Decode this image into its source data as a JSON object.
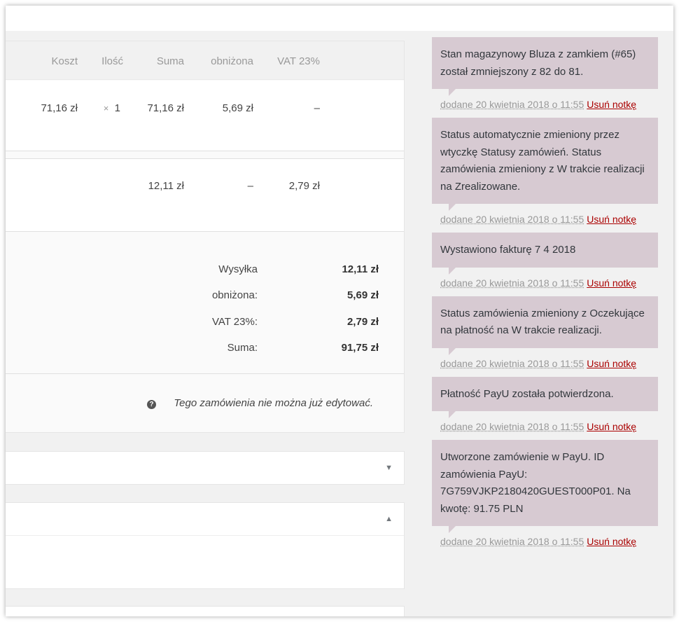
{
  "items_table": {
    "columns": [
      "Koszt",
      "Ilość",
      "Suma",
      "obniżona",
      "VAT 23%"
    ],
    "product_row": {
      "cost": "71,16 zł",
      "qty_x": "×",
      "qty": "1",
      "total": "71,16 zł",
      "discount": "5,69 zł",
      "vat": "–"
    },
    "shipping_row": {
      "total": "12,11 zł",
      "discount": "–",
      "vat": "2,79 zł"
    }
  },
  "totals": [
    {
      "label": "Wysyłka",
      "value": "12,11 zł"
    },
    {
      "label": "obniżona:",
      "value": "5,69 zł"
    },
    {
      "label": "VAT 23%:",
      "value": "2,79 zł"
    },
    {
      "label": "Suma:",
      "value": "91,75 zł"
    }
  ],
  "notice": {
    "icon": "?",
    "text": "Tego zamówienia nie można już edytować."
  },
  "boxes": {
    "box1_toggle": "▼",
    "box2_toggle": "▲"
  },
  "colors": {
    "note_bg": "#d7cad2",
    "delete_link": "#aa0000"
  },
  "notes": [
    {
      "text": "Stan magazynowy Bluza z zamkiem (#65) został zmniejszony z 82 do 81.",
      "date": "dodane 20 kwietnia 2018 o 11:55",
      "delete": "Usuń notkę"
    },
    {
      "text": "Status automatycznie zmieniony przez wtyczkę Statusy zamówień. Status zamówienia zmieniony z W trakcie realizacji na Zrealizowane.",
      "date": "dodane 20 kwietnia 2018 o 11:55",
      "delete": "Usuń notkę"
    },
    {
      "text": "Wystawiono fakturę 7 4 2018",
      "date": "dodane 20 kwietnia 2018 o 11:55",
      "delete": "Usuń notkę"
    },
    {
      "text": "Status zamówienia zmieniony z Oczekujące na płatność na W trakcie realizacji.",
      "date": "dodane 20 kwietnia 2018 o 11:55",
      "delete": "Usuń notkę"
    },
    {
      "text": "Płatność PayU została potwierdzona.",
      "date": "dodane 20 kwietnia 2018 o 11:55",
      "delete": "Usuń notkę"
    },
    {
      "text": "Utworzone zamówienie w PayU. ID zamówienia PayU: 7G759VJKP2180420GUEST000P01. Na kwotę: 91.75 PLN",
      "date": "dodane 20 kwietnia 2018 o 11:55",
      "delete": "Usuń notkę"
    }
  ]
}
